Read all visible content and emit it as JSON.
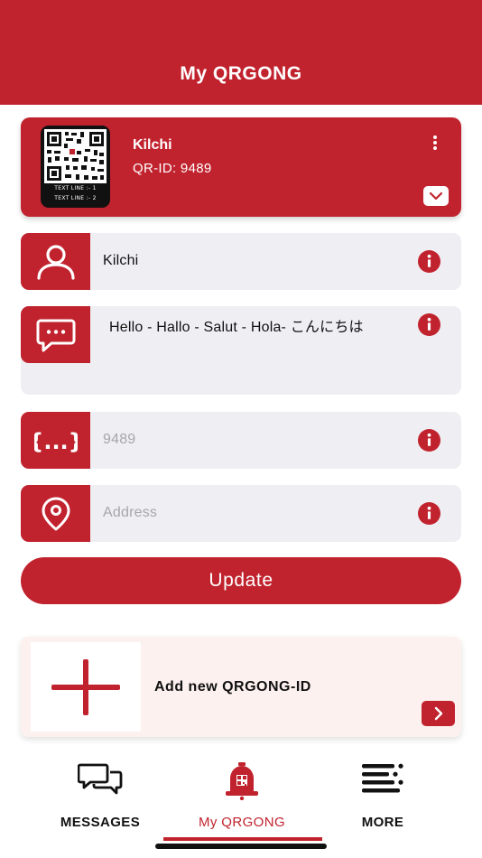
{
  "header": {
    "title": "My QRGONG"
  },
  "qr_card": {
    "name": "Kilchi",
    "qr_id": "QR-ID: 9489",
    "thumb_line_1": "TEXT LINE :- 1",
    "thumb_line_2": "TEXT LINE :- 2",
    "icons": {
      "more": "kebab-menu-icon",
      "expand": "chevron-down-icon"
    }
  },
  "fields": {
    "name": {
      "value": "Kilchi",
      "icon": "user-icon"
    },
    "message": {
      "value": "Hello - Hallo - Salut - Hola- こんにちは",
      "icon": "chat-bubble-icon"
    },
    "code": {
      "placeholder": "9489",
      "icon": "curly-braces-icon"
    },
    "address": {
      "placeholder": "Address",
      "icon": "location-pin-icon"
    }
  },
  "update_button": {
    "label": "Update"
  },
  "add_card": {
    "label": "Add new QRGONG-ID"
  },
  "tabs": [
    {
      "label": "MESSAGES",
      "icon": "chat-bubbles-icon",
      "active": false
    },
    {
      "label": "My QRGONG",
      "icon": "bell-qr-icon",
      "active": true
    },
    {
      "label": "MORE",
      "icon": "menu-list-icon",
      "active": false
    }
  ],
  "colors": {
    "brand": "#c1232e",
    "field_bg": "#efeef3",
    "add_card_bg": "#fdf1ef"
  }
}
